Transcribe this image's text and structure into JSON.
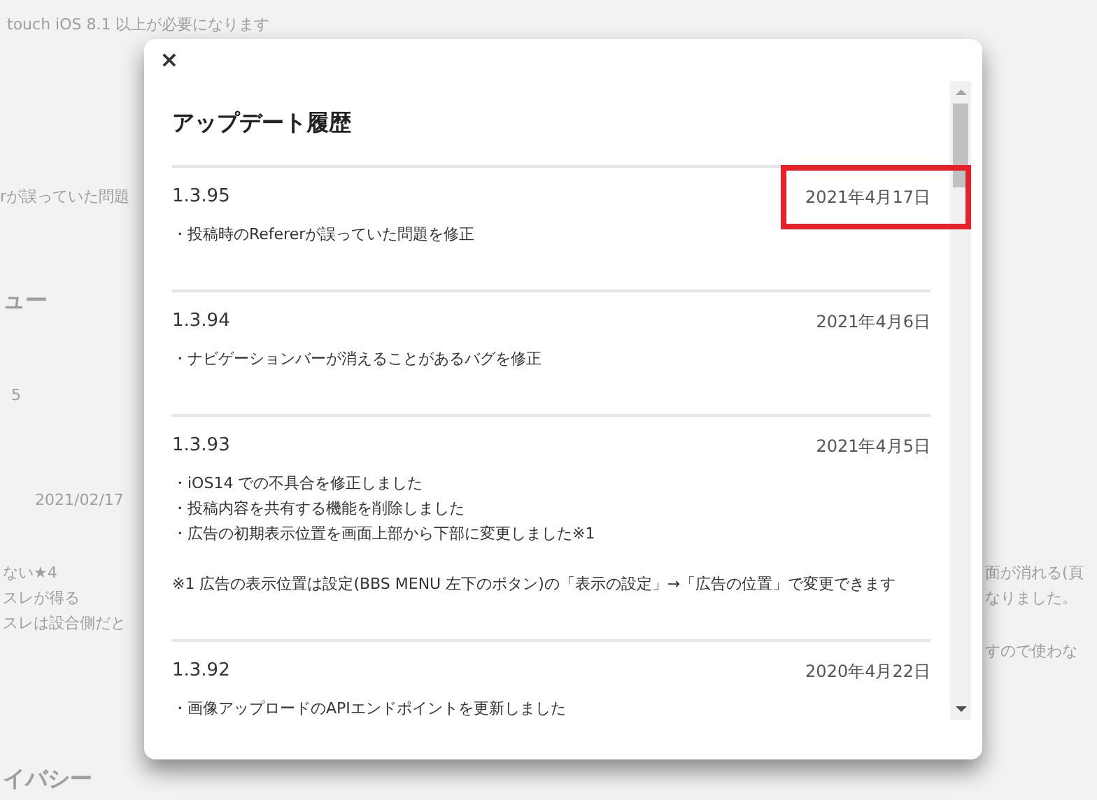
{
  "background": {
    "texts": [
      "touch iOS 8.1 以上が必要になります",
      "rが誤っていた問題",
      "ュー",
      "5",
      "2021/02/17",
      "ない★4",
      "スレが得る",
      "スレは設合側だと",
      "面が消れる(頁",
      "なりました。",
      "すので使わな",
      "イバシー"
    ]
  },
  "modal": {
    "title": "アップデート履歴",
    "close": "×",
    "entries": [
      {
        "version": "1.3.95",
        "date": "2021年4月17日",
        "highlighted": true,
        "lines": [
          "・投稿時のRefererが誤っていた問題を修正"
        ]
      },
      {
        "version": "1.3.94",
        "date": "2021年4月6日",
        "highlighted": false,
        "lines": [
          "・ナビゲーションバーが消えることがあるバグを修正"
        ]
      },
      {
        "version": "1.3.93",
        "date": "2021年4月5日",
        "highlighted": false,
        "lines": [
          "・iOS14 での不具合を修正しました",
          "・投稿内容を共有する機能を削除しました",
          "・広告の初期表示位置を画面上部から下部に変更しました※1"
        ],
        "note": "※1 広告の表示位置は設定(BBS MENU 左下のボタン)の「表示の設定」→「広告の位置」で変更できます"
      },
      {
        "version": "1.3.92",
        "date": "2020年4月22日",
        "highlighted": false,
        "lines": [
          "・画像アップロードのAPIエンドポイントを更新しました"
        ]
      }
    ]
  }
}
